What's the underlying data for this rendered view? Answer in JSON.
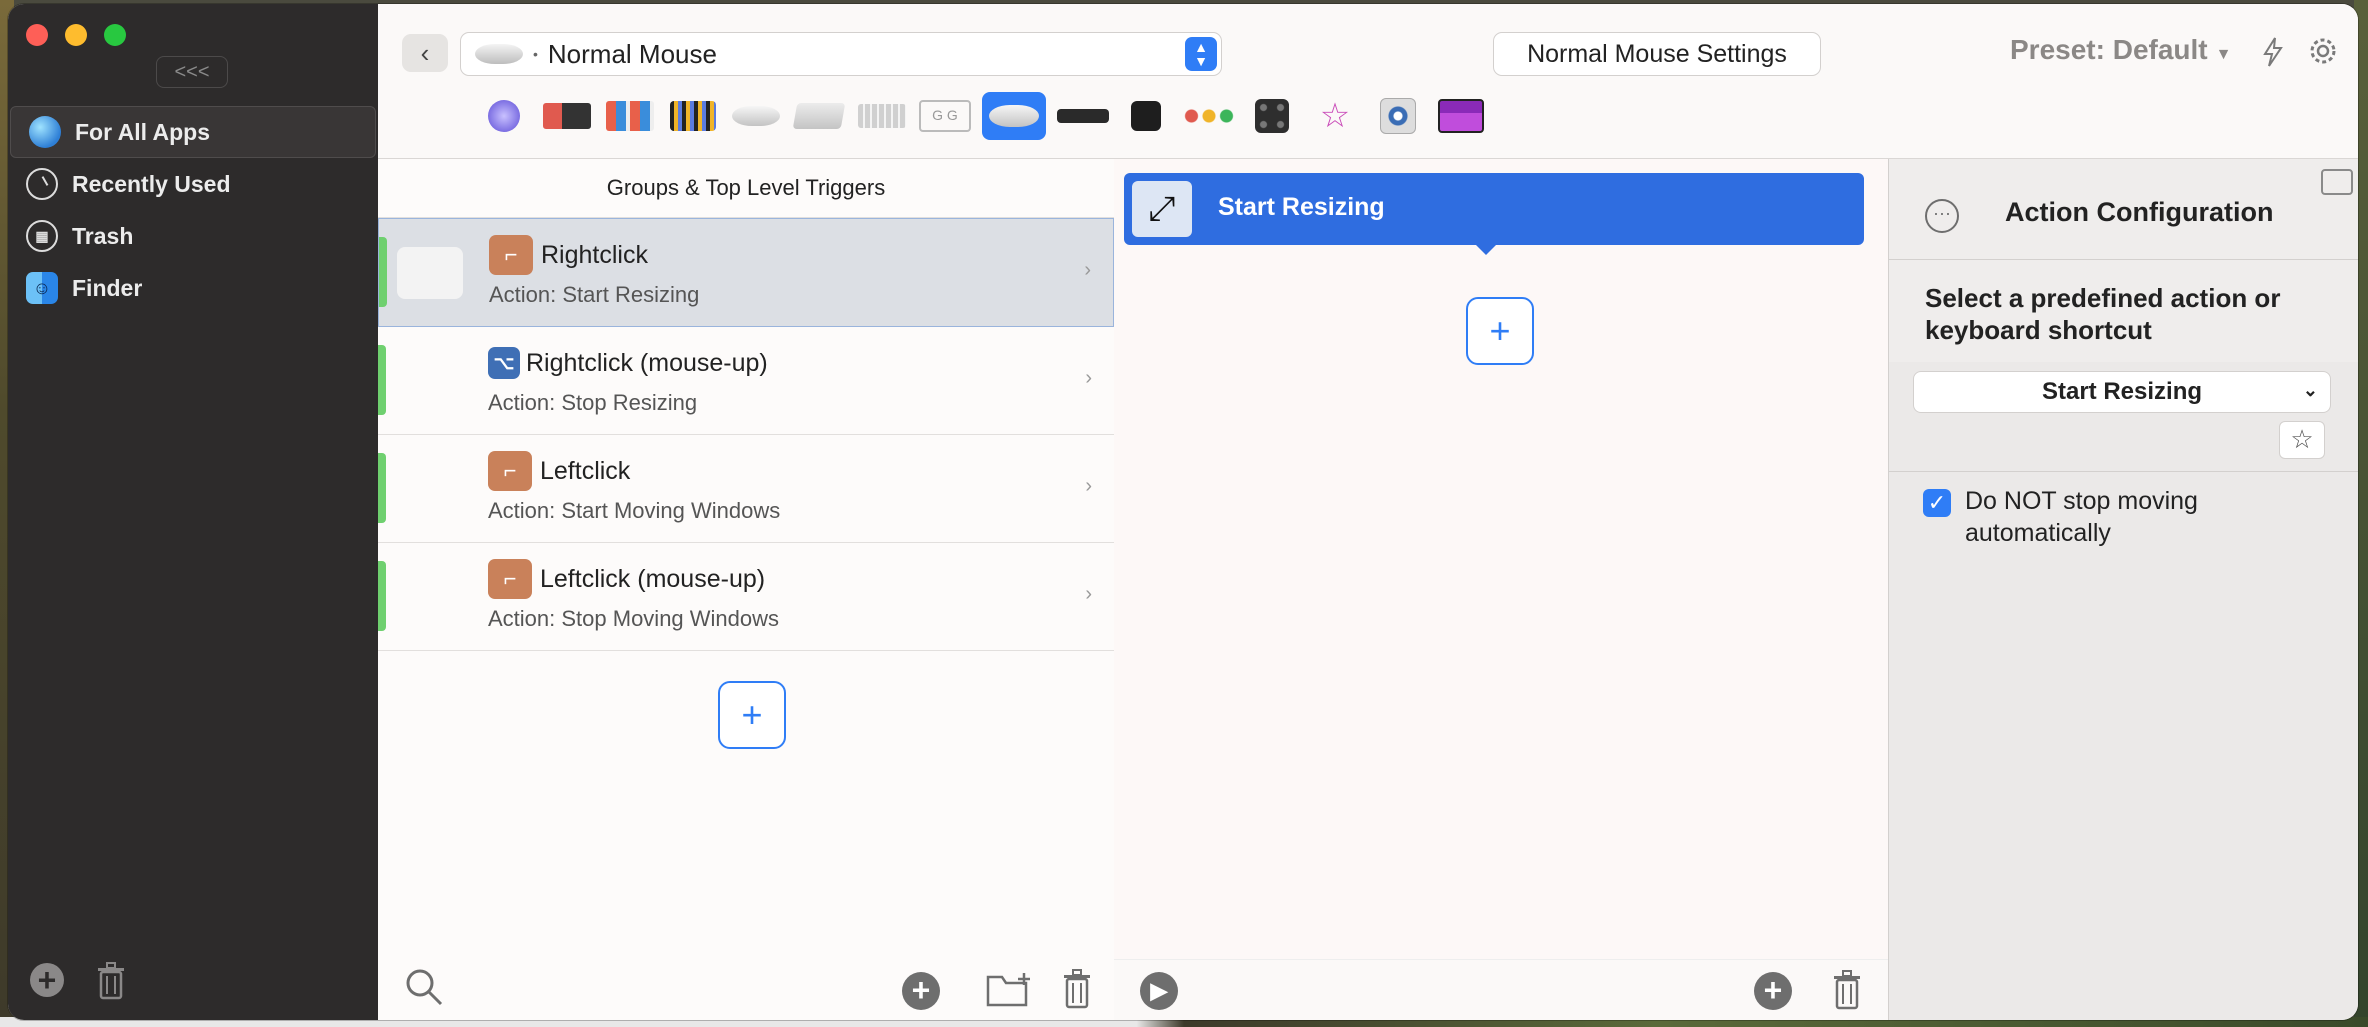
{
  "window": {
    "collapse_label": "<<<"
  },
  "sidebar": {
    "items": [
      {
        "label": "For All Apps"
      },
      {
        "label": "Recently Used"
      },
      {
        "label": "Trash"
      },
      {
        "label": "Finder"
      }
    ]
  },
  "toolbar": {
    "device_name": "Normal Mouse",
    "settings_label": "Normal Mouse Settings",
    "preset_label": "Preset: Default"
  },
  "triggers": {
    "header": "Groups & Top Level Triggers",
    "items": [
      {
        "title": "Rightclick",
        "action": "Action: Start Resizing",
        "selected": true
      },
      {
        "title": "Rightclick (mouse-up)",
        "action": "Action: Stop Resizing"
      },
      {
        "title": "Leftclick",
        "action": "Action: Start Moving Windows"
      },
      {
        "title": "Leftclick (mouse-up)",
        "action": "Action: Stop Moving Windows"
      }
    ]
  },
  "actions": {
    "items": [
      {
        "label": "Start Resizing"
      }
    ]
  },
  "config": {
    "title": "Action Configuration",
    "predefined_prompt": "Select a predefined action or keyboard shortcut",
    "selected_action": "Start Resizing",
    "checkbox_label": "Do NOT stop moving automatically",
    "checkbox_checked": true
  },
  "colors": {
    "accent": "#2f7df6",
    "sidebar_bg": "#2d2b2b",
    "trigger_bar": "#6fd06f"
  }
}
